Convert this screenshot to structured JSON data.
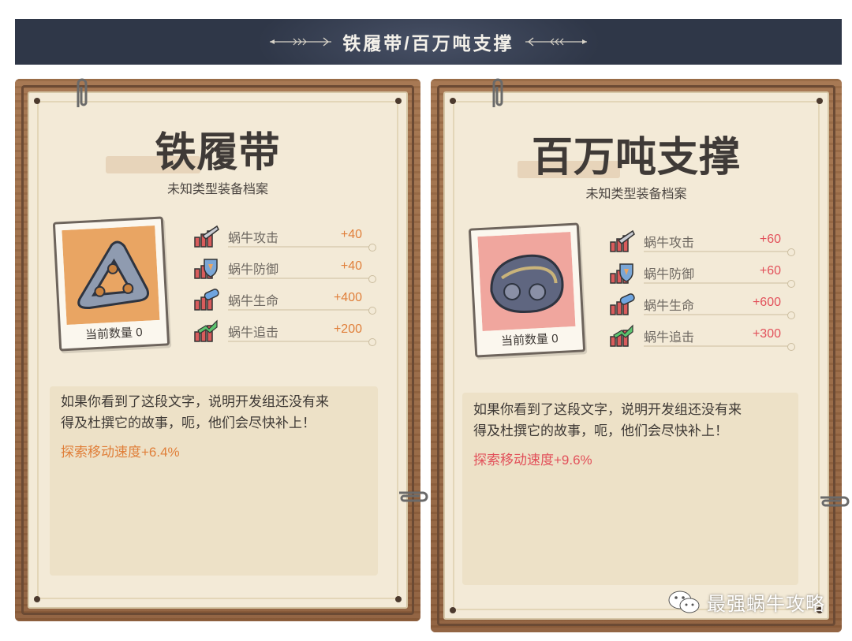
{
  "header": {
    "title": "铁履带/百万吨支撑"
  },
  "colors": {
    "banner_bg": "#2f3748",
    "value_orange": "#e07f3a",
    "value_red": "#e2505a",
    "portrait_orange": "#e9a563",
    "portrait_pink": "#f0a69e"
  },
  "cards": [
    {
      "title": "铁履带",
      "subtitle": "未知类型装备档案",
      "count_label": "当前数量",
      "count": "0",
      "stats": [
        {
          "icon": "attack-icon",
          "label": "蜗牛攻击",
          "value": "+40"
        },
        {
          "icon": "defense-icon",
          "label": "蜗牛防御",
          "value": "+40"
        },
        {
          "icon": "life-icon",
          "label": "蜗牛生命",
          "value": "+400"
        },
        {
          "icon": "pursuit-icon",
          "label": "蜗牛追击",
          "value": "+200"
        }
      ],
      "description_line1": "如果你看到了这段文字，说明开发组还没有来",
      "description_line2": "得及杜撰它的故事，呃，他们会尽快补上！",
      "bonus": "探索移动速度+6.4%"
    },
    {
      "title": "百万吨支撑",
      "subtitle": "未知类型装备档案",
      "count_label": "当前数量",
      "count": "0",
      "stats": [
        {
          "icon": "attack-icon",
          "label": "蜗牛攻击",
          "value": "+60"
        },
        {
          "icon": "defense-icon",
          "label": "蜗牛防御",
          "value": "+60"
        },
        {
          "icon": "life-icon",
          "label": "蜗牛生命",
          "value": "+600"
        },
        {
          "icon": "pursuit-icon",
          "label": "蜗牛追击",
          "value": "+300"
        }
      ],
      "description_line1": "如果你看到了这段文字，说明开发组还没有来",
      "description_line2": "得及杜撰它的故事，呃，他们会尽快补上！",
      "bonus": "探索移动速度+9.6%"
    }
  ],
  "watermark": {
    "text": "最强蜗牛攻略",
    "icon": "wechat-icon"
  }
}
